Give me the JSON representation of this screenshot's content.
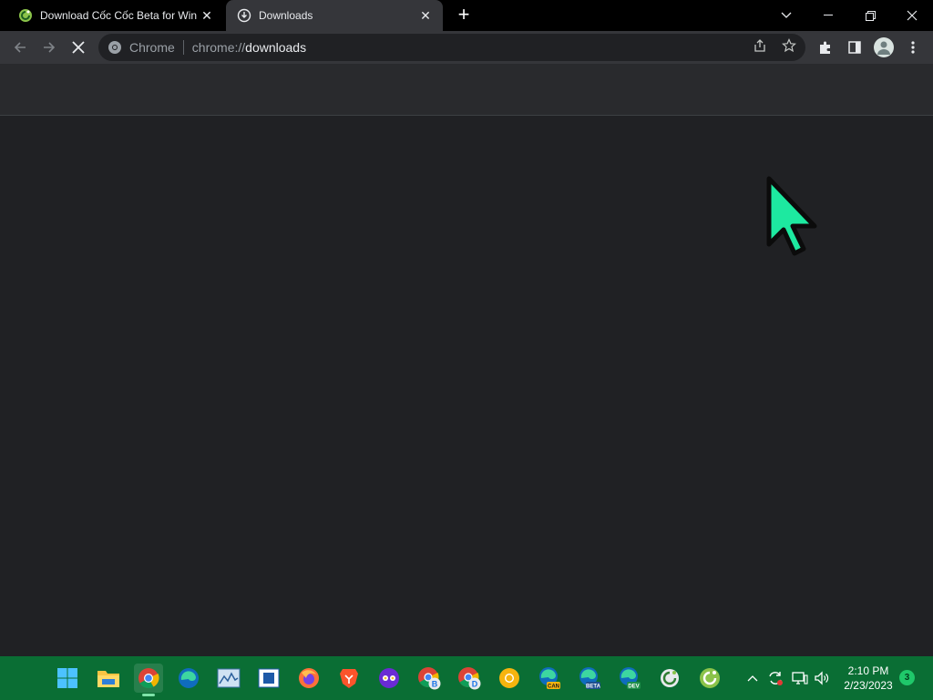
{
  "tabs": [
    {
      "title": "Download Cốc Cốc Beta for Windows",
      "favicon": "coccoc-icon",
      "active": false
    },
    {
      "title": "Downloads",
      "favicon": "download-icon",
      "active": true
    }
  ],
  "window_controls": {
    "list": "chevron-down-icon",
    "minimize": "minimize-icon",
    "maximize": "restore-icon",
    "close": "close-icon"
  },
  "omnibox": {
    "chip": "Chrome",
    "scheme": "chrome://",
    "path": "downloads"
  },
  "taskbar": {
    "apps": [
      "start",
      "file-explorer",
      "chrome",
      "edge",
      "resource-monitor",
      "window-app",
      "firefox",
      "brave",
      "incognito-app",
      "chrome-beta",
      "chrome-dev",
      "chrome-canary",
      "edge-canary",
      "edge-beta",
      "edge-dev",
      "coccoc-beta",
      "coccoc"
    ],
    "edge_badges": {
      "canary": "CAN",
      "beta": "BETA",
      "dev": "DEV"
    },
    "chrome_badges": {
      "beta": "B",
      "dev": "D"
    }
  },
  "clock": {
    "time": "2:10 PM",
    "date": "2/23/2023"
  },
  "notifications": {
    "count": "3"
  },
  "colors": {
    "cursor": "#1de9a0",
    "taskbar": "#0a6e34",
    "toolbar": "#35363a",
    "page": "#202124"
  }
}
